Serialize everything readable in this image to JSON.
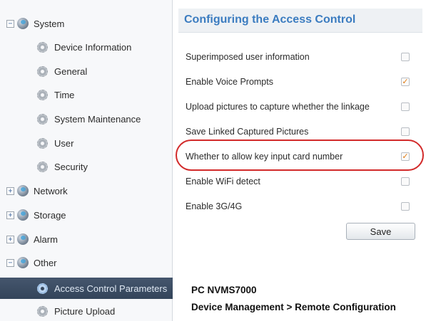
{
  "sidebar": {
    "items": [
      {
        "label": "System",
        "toggle": "−",
        "level": 0
      },
      {
        "label": "Device Information",
        "level": 1
      },
      {
        "label": "General",
        "level": 1
      },
      {
        "label": "Time",
        "level": 1
      },
      {
        "label": "System Maintenance",
        "level": 1
      },
      {
        "label": "User",
        "level": 1
      },
      {
        "label": "Security",
        "level": 1
      },
      {
        "label": "Network",
        "toggle": "+",
        "level": 0
      },
      {
        "label": "Storage",
        "toggle": "+",
        "level": 0
      },
      {
        "label": "Alarm",
        "toggle": "+",
        "level": 0
      },
      {
        "label": "Other",
        "toggle": "−",
        "level": 0
      },
      {
        "label": "Access Control Parameters",
        "level": 1,
        "selected": true
      },
      {
        "label": "Picture Upload",
        "level": 1
      }
    ]
  },
  "panel": {
    "title": "Configuring the Access Control",
    "options": [
      {
        "label": "Superimposed user information",
        "checked": false
      },
      {
        "label": "Enable Voice Prompts",
        "checked": true
      },
      {
        "label": "Upload pictures to capture whether the linkage",
        "checked": false
      },
      {
        "label": "Save Linked Captured Pictures",
        "checked": false
      },
      {
        "label": "Whether to allow key input card number",
        "checked": true
      },
      {
        "label": "Enable WiFi detect",
        "checked": false
      },
      {
        "label": "Enable 3G/4G",
        "checked": false
      }
    ],
    "save_label": "Save"
  },
  "caption": {
    "line1": "PC NVMS7000",
    "line2": "Device Management > Remote Configuration"
  },
  "colors": {
    "accent": "#3b7cc0",
    "selected_bg": "#3c4d63",
    "highlight": "#d22a2a",
    "check": "#e07b14"
  }
}
